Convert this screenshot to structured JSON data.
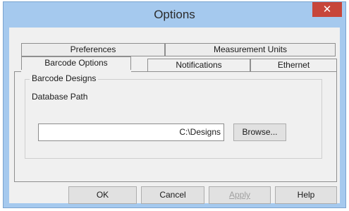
{
  "window": {
    "title": "Options",
    "close_glyph": "✕"
  },
  "tabs": {
    "back_row": [
      {
        "label": "Preferences"
      },
      {
        "label": "Measurement Units"
      }
    ],
    "front_row": [
      {
        "label": "Barcode Options"
      },
      {
        "label": "Notifications"
      },
      {
        "label": "Ethernet"
      }
    ],
    "active": "Barcode Options"
  },
  "barcode_designs": {
    "group_title": "Barcode Designs",
    "database_path_label": "Database Path",
    "database_path_value": "C:\\Designs",
    "browse_label": "Browse..."
  },
  "footer": {
    "ok_label": "OK",
    "cancel_label": "Cancel",
    "apply_label": "Apply",
    "help_label": "Help"
  },
  "colors": {
    "titlebar_bg": "#a5c9ee",
    "close_bg": "#c7463a",
    "client_bg": "#f0f0f0"
  }
}
